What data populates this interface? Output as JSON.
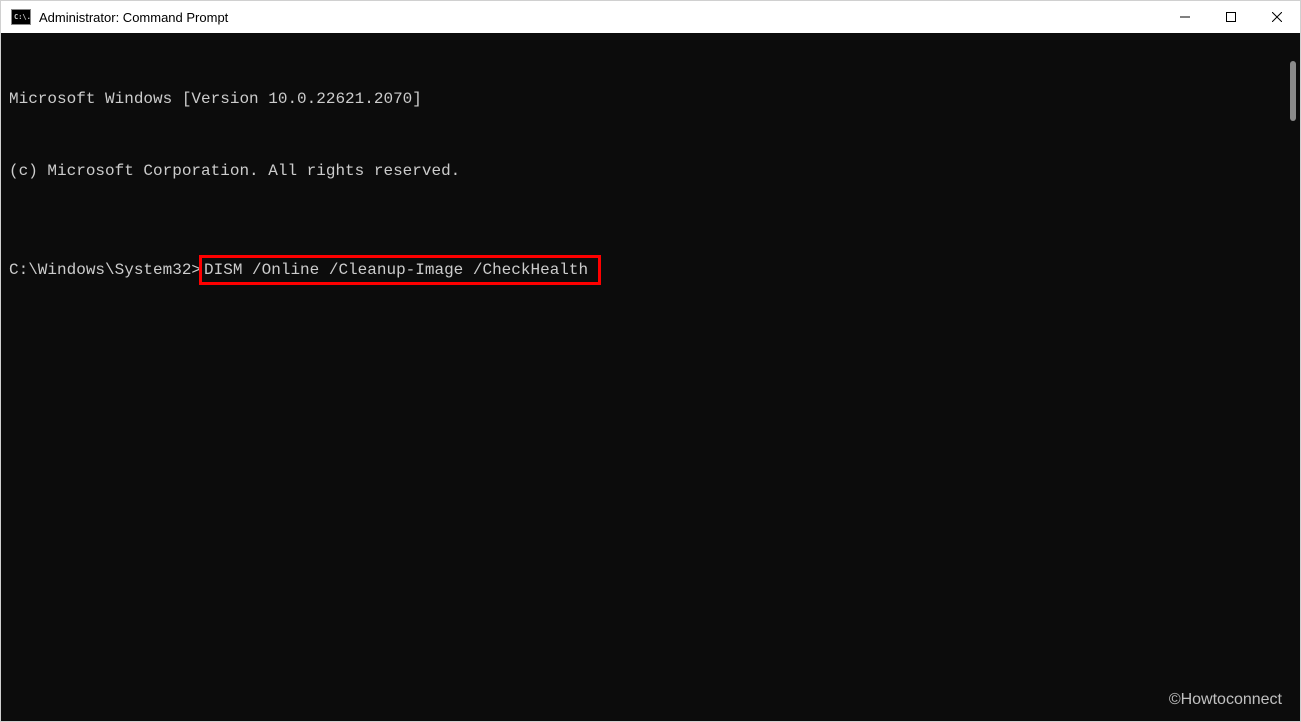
{
  "titlebar": {
    "icon_label": "C:\\.",
    "title": "Administrator: Command Prompt"
  },
  "terminal": {
    "line1": "Microsoft Windows [Version 10.0.22621.2070]",
    "line2": "(c) Microsoft Corporation. All rights reserved.",
    "prompt": "C:\\Windows\\System32>",
    "command": "DISM /Online /Cleanup-Image /CheckHealth"
  },
  "watermark": "©Howtoconnect"
}
